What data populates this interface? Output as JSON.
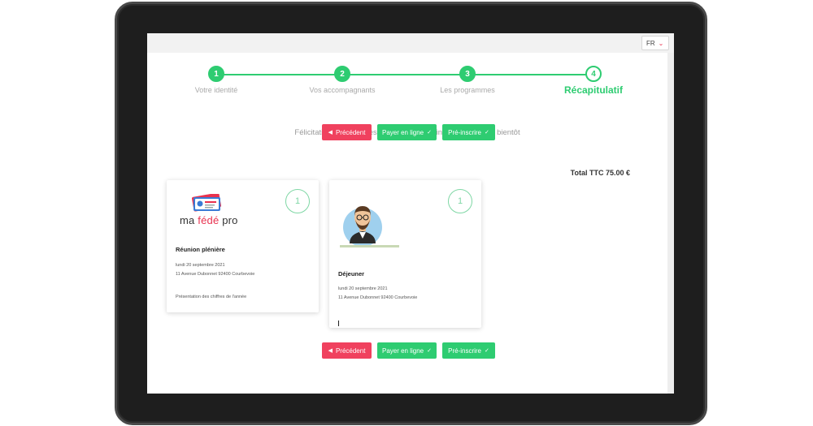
{
  "language_selector": {
    "value": "FR",
    "icon": "chevron-down-icon"
  },
  "stepper": {
    "steps": [
      {
        "number": "1",
        "label": "Votre identité"
      },
      {
        "number": "2",
        "label": "Vos accompagnants"
      },
      {
        "number": "3",
        "label": "Les programmes"
      },
      {
        "number": "4",
        "label": "Récapitulatif"
      }
    ],
    "active_index": 3
  },
  "message": "Félicitations ! Il vous reste à valider votre inscription. A très bientôt",
  "buttons": {
    "previous": "Précédent",
    "pay_online": "Payer en ligne",
    "pre_register": "Pré-inscrire"
  },
  "total": "Total TTC 75.00 €",
  "cards": [
    {
      "logo_text_prefix": "ma ",
      "logo_text_accent": "fédé",
      "logo_text_suffix": " pro",
      "quantity": "1",
      "title": "Réunion plénière",
      "date": "lundi 20 septembre 2021",
      "address": "11 Avenue Dubonnet 92400 Courbevoie",
      "description": "Présentation des chiffres de l'année"
    },
    {
      "quantity": "1",
      "title": "Déjeuner",
      "date": "lundi 20 septembre 2021",
      "address": "11 Avenue Dubonnet 92400 Courbevoie"
    }
  ],
  "colors": {
    "green": "#2ecc71",
    "red": "#f0415e",
    "frame": "#1e1e1e"
  }
}
